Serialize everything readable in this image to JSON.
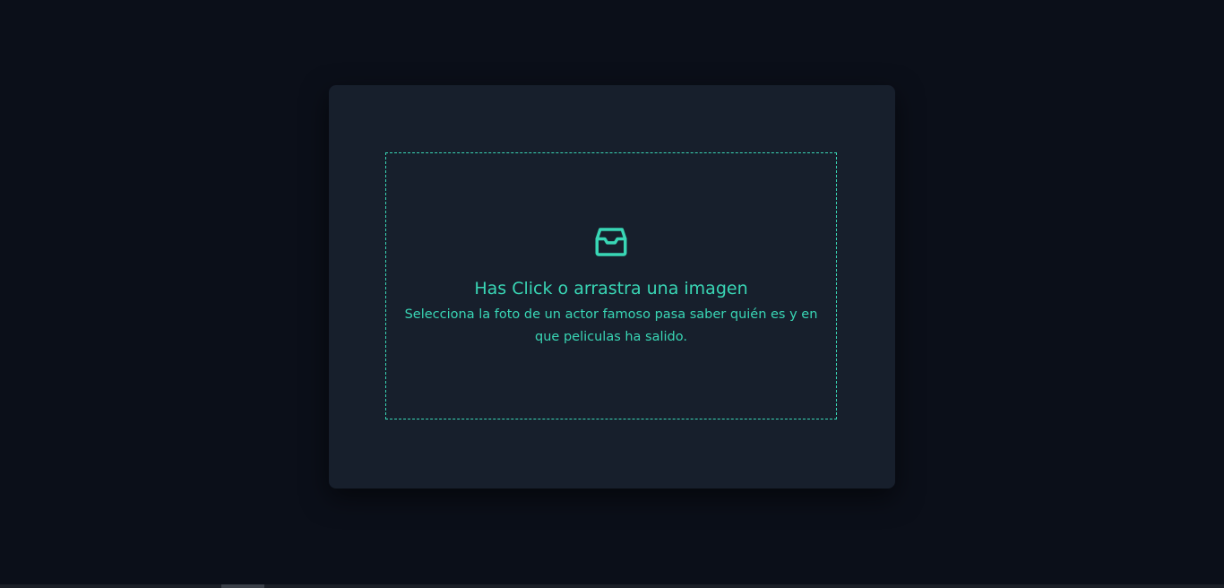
{
  "dropzone": {
    "icon": "inbox-icon",
    "title": "Has Click o arrastra una imagen",
    "subtitle": "Selecciona la foto de un actor famoso pasa saber quién es y en que peliculas ha salido."
  },
  "colors": {
    "background": "#0b0f19",
    "card": "#171f2c",
    "accent": "#39d6b5"
  }
}
